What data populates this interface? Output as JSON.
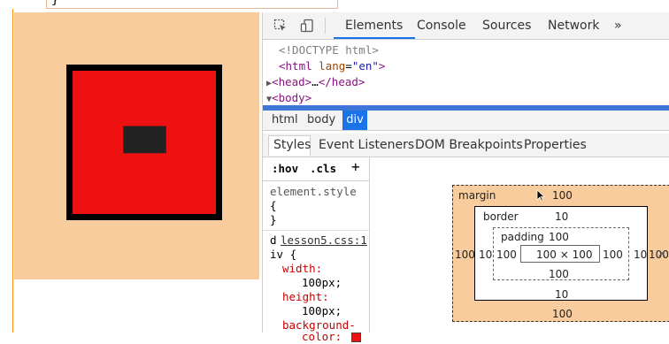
{
  "code_strip": {
    "brace": "}"
  },
  "preview": {
    "box_text_lines": [
      "████████",
      "████████",
      "████████"
    ]
  },
  "devtools": {
    "tabs": [
      "Elements",
      "Console",
      "Sources",
      "Network"
    ],
    "more_tabs": "»",
    "dom": {
      "doctype": "<!DOCTYPE html>",
      "html_tag": "html",
      "html_attr": "lang",
      "html_attr_val": "\"en\"",
      "head": "head",
      "head_ellipsis": "…",
      "body": "body"
    },
    "breadcrumb": [
      "html",
      "body",
      "div"
    ],
    "subtabs": [
      "Styles",
      "Event Listeners",
      "DOM Breakpoints",
      "Properties"
    ],
    "styles": {
      "filter_hov": ":hov",
      "filter_cls": ".cls",
      "add": "+",
      "element_style": "element.style",
      "open_brace": "{",
      "close_brace": "}",
      "selector_d": "d",
      "source_link": "lesson5.css:1",
      "selector_iv": "iv {",
      "width_prop": "width:",
      "width_val": "100px;",
      "height_prop": "height:",
      "height_val": "100px;",
      "bg_prop": "background-",
      "bg_prop2": "color:"
    },
    "box_model": {
      "margin_label": "margin",
      "margin_top": "100",
      "margin_left": "100",
      "margin_right": "100",
      "margin_bottom": "100",
      "border_label": "border",
      "border_top": "10",
      "border_left": "10",
      "border_right": "10",
      "border_bottom": "10",
      "padding_label": "padding",
      "padding_top": "100",
      "padding_left": "100",
      "padding_right": "100",
      "padding_bottom": "100",
      "content": "100 × 100"
    }
  },
  "colors": {
    "margin": "#f8cc9d",
    "red_box": "#ee1111",
    "selection": "#1a73e8"
  }
}
